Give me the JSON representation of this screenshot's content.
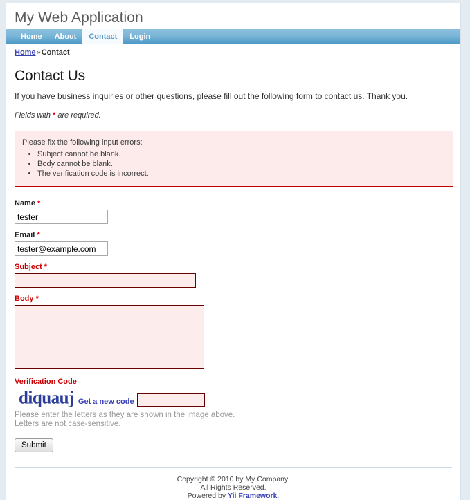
{
  "header": {
    "app_title": "My Web Application"
  },
  "nav": {
    "items": [
      {
        "label": "Home",
        "active": false
      },
      {
        "label": "About",
        "active": false
      },
      {
        "label": "Contact",
        "active": true
      },
      {
        "label": "Login",
        "active": false
      }
    ]
  },
  "breadcrumb": {
    "home_label": "Home",
    "separator": "»",
    "current": "Contact"
  },
  "content": {
    "page_title": "Contact Us",
    "intro": "If you have business inquiries or other questions, please fill out the following form to contact us. Thank you.",
    "required_note_before": "Fields with ",
    "required_note_star": "*",
    "required_note_after": " are required."
  },
  "error_summary": {
    "heading": "Please fix the following input errors:",
    "errors": [
      "Subject cannot be blank.",
      "Body cannot be blank.",
      "The verification code is incorrect."
    ]
  },
  "form": {
    "name": {
      "label": "Name",
      "required_marker": "*",
      "value": "tester",
      "placeholder": "",
      "has_error": false
    },
    "email": {
      "label": "Email",
      "required_marker": "*",
      "value": "tester@example.com",
      "placeholder": "",
      "has_error": false
    },
    "subject": {
      "label": "Subject",
      "required_marker": "*",
      "value": "",
      "placeholder": "",
      "has_error": true
    },
    "body": {
      "label": "Body",
      "required_marker": "*",
      "value": "",
      "placeholder": "",
      "has_error": true
    },
    "verification": {
      "label": "Verification Code",
      "captcha_text": "diquauj",
      "refresh_label": "Get a new code",
      "value": "",
      "placeholder": "",
      "hint_line1": "Please enter the letters as they are shown in the image above.",
      "hint_line2": "Letters are not case-sensitive.",
      "has_error": true
    },
    "submit_label": "Submit"
  },
  "footer": {
    "line1": "Copyright © 2010 by My Company.",
    "line2": "All Rights Reserved.",
    "line3_prefix": "Powered by ",
    "line3_link": "Yii Framework",
    "line3_suffix": "."
  },
  "colors": {
    "page_background": "#e4ecf1",
    "nav_gradient_top": "#8cc0dd",
    "nav_gradient_bottom": "#4b97c6",
    "active_tab_text": "#5b9bc4",
    "error_border": "#c00000",
    "error_background": "#fdeaea",
    "error_label": "#cc0000",
    "link": "#3a41b5",
    "captcha_text": "#2b3c9b",
    "hint_text": "#9a9a9a"
  }
}
